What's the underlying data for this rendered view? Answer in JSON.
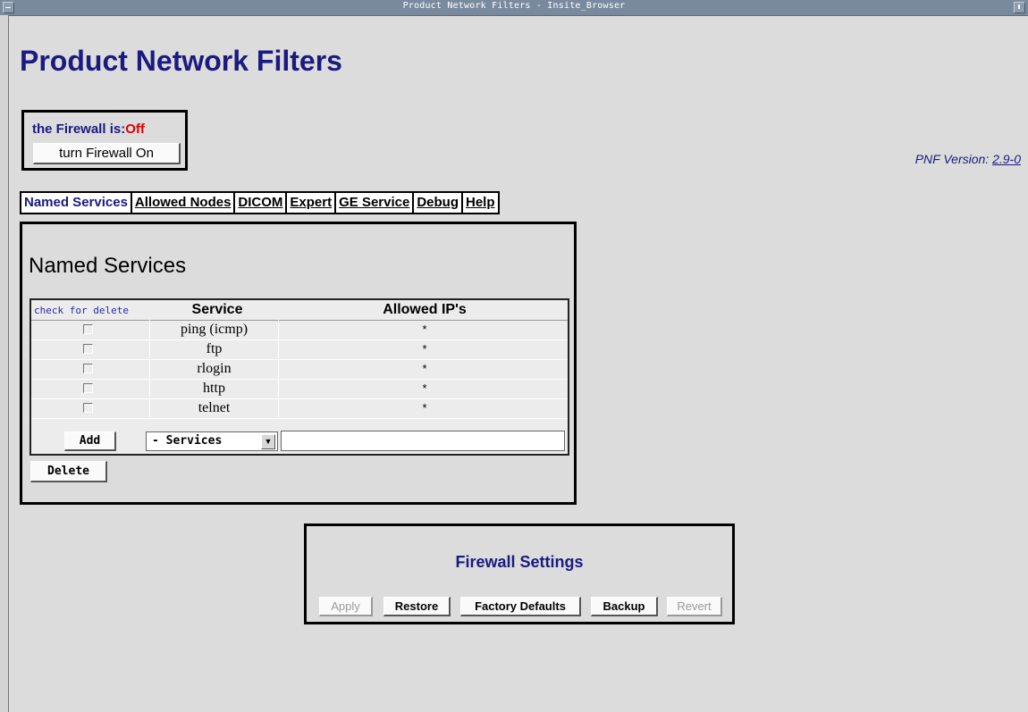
{
  "window": {
    "title": "Product Network Filters - Insite_Browser"
  },
  "page": {
    "title": "Product Network Filters"
  },
  "firewall": {
    "status_label": "the Firewall is:",
    "status_value": "Off",
    "toggle_label": "turn Firewall On"
  },
  "version": {
    "label": "PNF Version:",
    "value": "2.9-0"
  },
  "tabs": [
    "Named Services",
    "Allowed Nodes",
    "DICOM",
    "Expert",
    "GE Service",
    "Debug",
    "Help"
  ],
  "named_services": {
    "title": "Named Services",
    "columns": {
      "delete": "check for delete",
      "service": "Service",
      "ips": "Allowed IP's"
    },
    "rows": [
      {
        "service": "ping (icmp)",
        "ips": "*"
      },
      {
        "service": "ftp",
        "ips": "*"
      },
      {
        "service": "rlogin",
        "ips": "*"
      },
      {
        "service": "http",
        "ips": "*"
      },
      {
        "service": "telnet",
        "ips": "*"
      }
    ],
    "add_label": "Add",
    "select_value": "- Services",
    "ip_input_value": "",
    "delete_label": "Delete"
  },
  "settings": {
    "title": "Firewall Settings",
    "apply": "Apply",
    "restore": "Restore",
    "factory": "Factory Defaults",
    "backup": "Backup",
    "revert": "Revert"
  }
}
